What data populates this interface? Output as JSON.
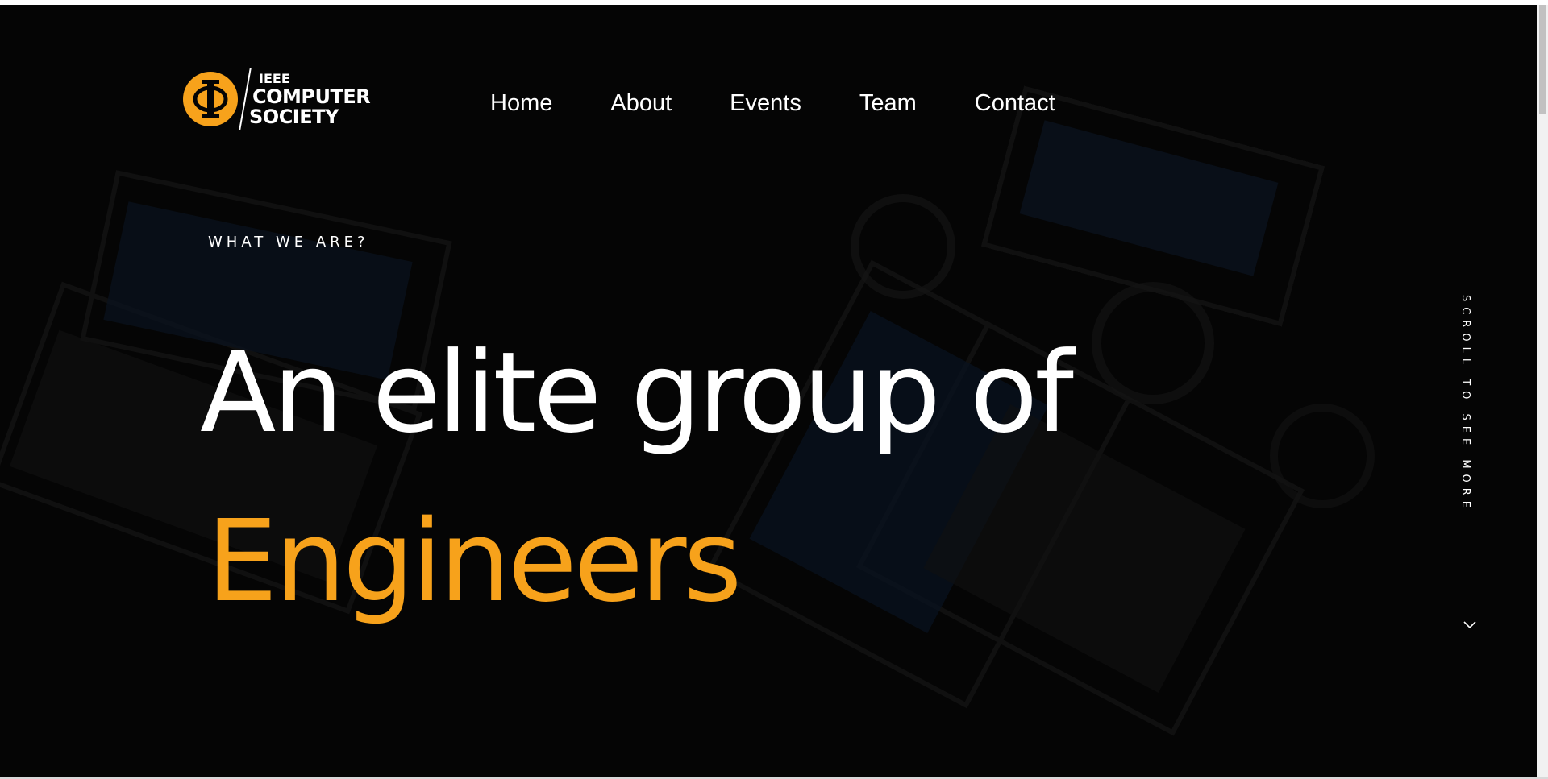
{
  "brand": {
    "logo_line1": "IEEE",
    "logo_line2": "COMPUTER",
    "logo_line3": "SOCIETY",
    "accent_color": "#f7a21b"
  },
  "nav": {
    "items": [
      "Home",
      "About",
      "Events",
      "Team",
      "Contact"
    ]
  },
  "hero": {
    "eyebrow": "WHAT WE ARE?",
    "headline": "An elite group of",
    "headline_accent": "Engineers"
  },
  "scroll_hint": {
    "label": "SCROLL TO SEE MORE",
    "icon": "chevron-down-icon"
  }
}
